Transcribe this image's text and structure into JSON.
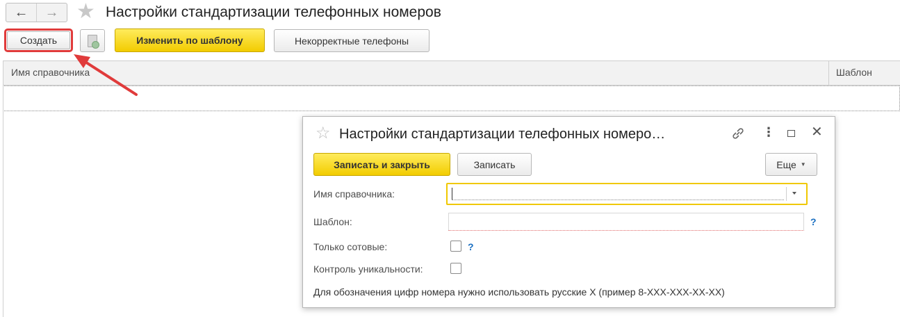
{
  "window": {
    "title": "Настройки стандартизации телефонных номеров",
    "nav_back_icon": "←",
    "nav_forward_icon": "→",
    "favorite_icon": "★"
  },
  "toolbar": {
    "create_label": "Создать",
    "change_by_template_label": "Изменить по шаблону",
    "incorrect_phones_label": "Некорректные телефоны"
  },
  "list": {
    "columns": [
      "Имя справочника",
      "Шаблон"
    ]
  },
  "dialog": {
    "title": "Настройки стандартизации телефонных номеро…",
    "favorite_icon": "☆",
    "more_icon": "⋮",
    "close_icon": "✕",
    "save_close_label": "Записать и закрыть",
    "save_label": "Записать",
    "more_label": "Еще",
    "fields": {
      "directory_name_label": "Имя справочника:",
      "directory_name_value": "",
      "template_label": "Шаблон:",
      "template_value": "",
      "only_mobile_label": "Только сотовые:",
      "only_mobile_checked": false,
      "uniqueness_label": "Контроль уникальности:",
      "uniqueness_checked": false
    },
    "help_mark": "?",
    "note": "Для обозначения цифр номера нужно использовать русские Х (пример 8-ХХХ-ХХХ-ХХ-ХХ)"
  },
  "colors": {
    "accent_yellow": "#f5d20c",
    "highlight_red": "#e03b3b",
    "help_blue": "#1a6fc1"
  }
}
